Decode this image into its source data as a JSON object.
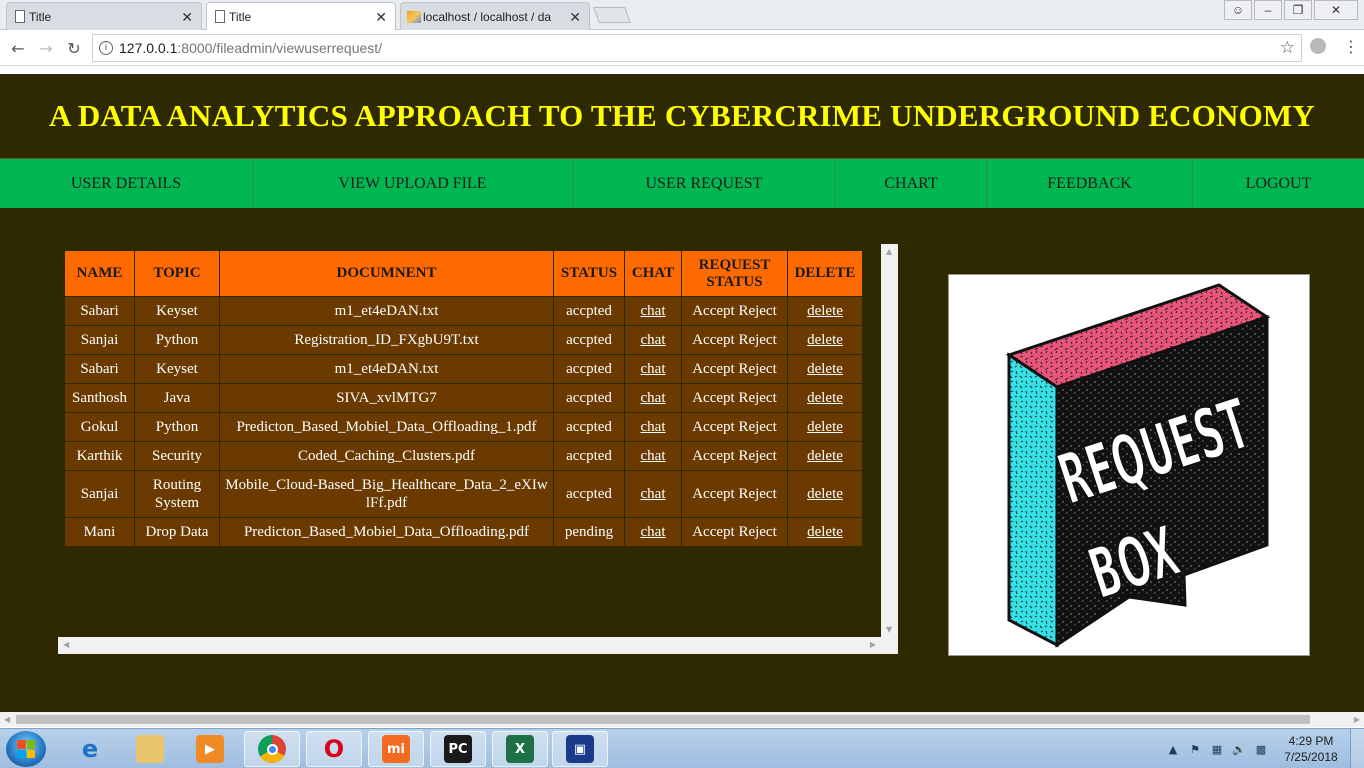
{
  "browser": {
    "tabs": [
      {
        "title": "Title",
        "close": "✕"
      },
      {
        "title": "Title",
        "close": "✕"
      },
      {
        "title": "localhost / localhost / da",
        "close": "✕"
      }
    ],
    "url_host": "127.0.0.1",
    "url_path": ":8000/fileadmin/viewuserrequest/",
    "window_controls": [
      "☺",
      "–",
      "❐",
      "✕"
    ]
  },
  "page": {
    "title": "A DATA ANALYTICS APPROACH TO THE CYBERCRIME UNDERGROUND ECONOMY",
    "nav": [
      "USER DETAILS",
      "VIEW UPLOAD FILE",
      "USER REQUEST",
      "CHART",
      "FEEDBACK",
      "LOGOUT"
    ],
    "table": {
      "headers": [
        "NAME",
        "TOPIC",
        "DOCUMNENT",
        "STATUS",
        "CHAT",
        "REQUEST STATUS",
        "DELETE"
      ],
      "rows": [
        {
          "name": "Sabari",
          "topic": "Keyset",
          "document": "m1_et4eDAN.txt",
          "status": "accpted",
          "chat": "chat",
          "request_status": "Accept Reject",
          "delete": "delete"
        },
        {
          "name": "Sanjai",
          "topic": "Python",
          "document": "Registration_ID_FXgbU9T.txt",
          "status": "accpted",
          "chat": "chat",
          "request_status": "Accept Reject",
          "delete": "delete"
        },
        {
          "name": "Sabari",
          "topic": "Keyset",
          "document": "m1_et4eDAN.txt",
          "status": "accpted",
          "chat": "chat",
          "request_status": "Accept Reject",
          "delete": "delete"
        },
        {
          "name": "Santhosh",
          "topic": "Java",
          "document": "SIVA_xvlMTG7",
          "status": "accpted",
          "chat": "chat",
          "request_status": "Accept Reject",
          "delete": "delete"
        },
        {
          "name": "Gokul",
          "topic": "Python",
          "document": "Predicton_Based_Mobiel_Data_Offloading_1.pdf",
          "status": "accpted",
          "chat": "chat",
          "request_status": "Accept Reject",
          "delete": "delete"
        },
        {
          "name": "Karthik",
          "topic": "Security",
          "document": "Coded_Caching_Clusters.pdf",
          "status": "accpted",
          "chat": "chat",
          "request_status": "Accept Reject",
          "delete": "delete"
        },
        {
          "name": "Sanjai",
          "topic": "Routing System",
          "document": "Mobile_Cloud-Based_Big_Healthcare_Data_2_eXIwlFf.pdf",
          "status": "accpted",
          "chat": "chat",
          "request_status": "Accept Reject",
          "delete": "delete"
        },
        {
          "name": "Mani",
          "topic": "Drop Data",
          "document": "Predicton_Based_Mobiel_Data_Offloading.pdf",
          "status": "pending",
          "chat": "chat",
          "request_status": "Accept Reject",
          "delete": "delete"
        }
      ]
    },
    "image_text": {
      "line1": "REQUEST",
      "line2": "BOX"
    }
  },
  "taskbar": {
    "apps": [
      {
        "name": "internet-explorer",
        "glyph": "e",
        "color": "#1e73c9"
      },
      {
        "name": "file-explorer",
        "glyph": "",
        "color": "#e9c46a"
      },
      {
        "name": "media-player",
        "glyph": "▶",
        "color": "#f08a24"
      },
      {
        "name": "chrome",
        "glyph": "",
        "color": "#db4437"
      },
      {
        "name": "opera",
        "glyph": "O",
        "color": "#d9001b"
      },
      {
        "name": "mi",
        "glyph": "mi",
        "color": "#f36b21"
      },
      {
        "name": "pycharm",
        "glyph": "PC",
        "color": "#1a1a1a"
      },
      {
        "name": "excel",
        "glyph": "X",
        "color": "#1e7145"
      },
      {
        "name": "remote-app",
        "glyph": "▣",
        "color": "#1b3a8c"
      }
    ],
    "time": "4:29 PM",
    "date": "7/25/2018"
  },
  "colors": {
    "page_bg": "#2e2900",
    "title": "#ffff00",
    "nav_bg": "#00b752",
    "table_header": "#ff6a00",
    "table_row": "#6b3a00"
  }
}
